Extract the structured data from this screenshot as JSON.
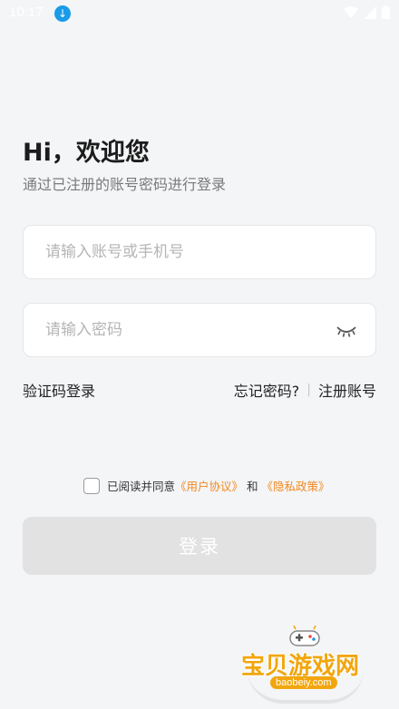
{
  "status_bar": {
    "time": "10:17",
    "download_icon": "download-circle-icon",
    "icons": [
      "wifi-icon",
      "signal-icon",
      "battery-icon"
    ]
  },
  "header": {
    "title": "Hi，欢迎您",
    "subtitle": "通过已注册的账号密码进行登录"
  },
  "form": {
    "account_placeholder": "请输入账号或手机号",
    "account_value": "",
    "password_placeholder": "请输入密码",
    "password_value": "",
    "password_toggle_icon": "eye-closed-icon"
  },
  "links": {
    "sms_login": "验证码登录",
    "forgot_password": "忘记密码?",
    "separator": "|",
    "register": "注册账号"
  },
  "agreement": {
    "prefix": "已阅读并同意",
    "user_agreement": "《用户协议》",
    "and": "和",
    "privacy_policy": "《隐私政策》",
    "checked": false
  },
  "login_button": {
    "label": "登录",
    "enabled": false
  },
  "watermark": {
    "text": "宝贝游戏网",
    "url": "baobeiy.com"
  },
  "colors": {
    "background": "#f4f5f7",
    "accent_link": "#f08a22",
    "button_disabled": "#e2e2e2",
    "watermark": "#f2a60c"
  }
}
